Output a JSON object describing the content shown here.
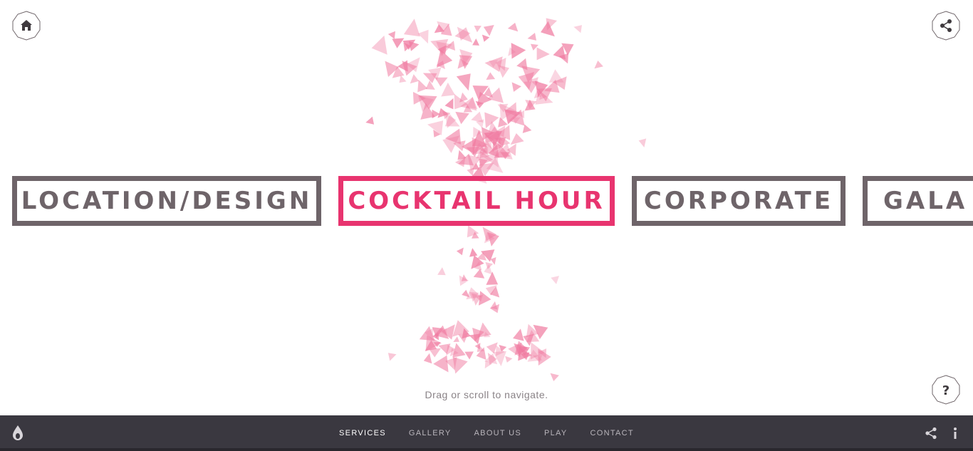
{
  "top_buttons": {
    "home_icon": "home-icon",
    "share_icon": "share-icon",
    "help_label": "?"
  },
  "categories": [
    {
      "label": "LOCATION/DESIGN",
      "active": false
    },
    {
      "label": "COCKTAIL HOUR",
      "active": true
    },
    {
      "label": "CORPORATE",
      "active": false
    },
    {
      "label": "GALA E",
      "active": false
    }
  ],
  "hint": "Drag or scroll to navigate.",
  "footer": {
    "logo_icon": "drop-logo-icon",
    "nav": [
      {
        "label": "SERVICES",
        "active": true
      },
      {
        "label": "GALLERY",
        "active": false
      },
      {
        "label": "ABOUT US",
        "active": false
      },
      {
        "label": "PLAY",
        "active": false
      },
      {
        "label": "CONTACT",
        "active": false
      }
    ],
    "share_icon": "share-icon",
    "info_icon": "info-icon"
  },
  "colors": {
    "accent": "#e8346f",
    "particle": "#f07aa0",
    "box_border": "#6e6469",
    "footer_bg": "#3a3840"
  }
}
